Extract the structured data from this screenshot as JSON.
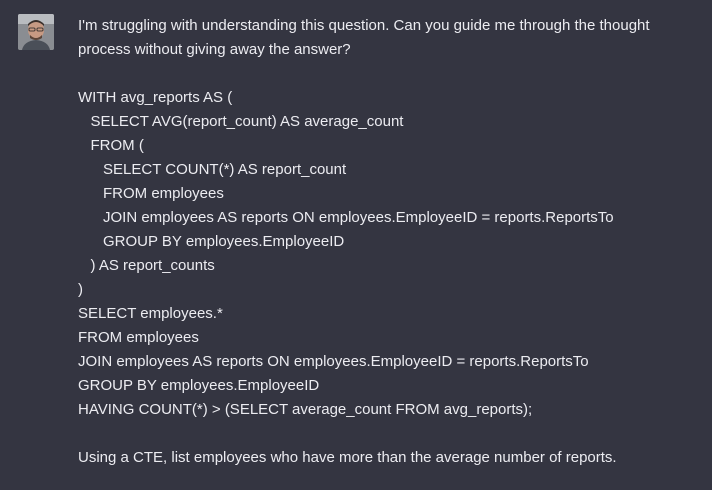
{
  "message": {
    "author": "user",
    "avatar_icon": "user-avatar",
    "intro_lines": [
      "I'm struggling with understanding this question. Can you guide me through the thought",
      "process without giving away the answer?"
    ],
    "code_lines": [
      "WITH avg_reports AS (",
      "   SELECT AVG(report_count) AS average_count",
      "   FROM (",
      "      SELECT COUNT(*) AS report_count",
      "      FROM employees",
      "      JOIN employees AS reports ON employees.EmployeeID = reports.ReportsTo",
      "      GROUP BY employees.EmployeeID",
      "   ) AS report_counts",
      ")",
      "SELECT employees.*",
      "FROM employees",
      "JOIN employees AS reports ON employees.EmployeeID = reports.ReportsTo",
      "GROUP BY employees.EmployeeID",
      "HAVING COUNT(*) > (SELECT average_count FROM avg_reports);"
    ],
    "closing_line": "Using a CTE, list employees who have more than the average number of reports."
  },
  "colors": {
    "background": "#343541",
    "text": "#ECECF1"
  }
}
